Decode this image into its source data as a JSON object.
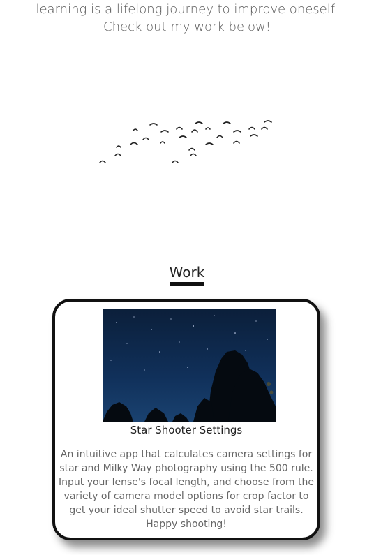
{
  "intro": {
    "line1": "learning is a lifelong journey to improve oneself.",
    "line2": "Check out my work below!"
  },
  "decoration": {
    "icon": "flock-of-birds-icon"
  },
  "work": {
    "heading": "Work",
    "projects": [
      {
        "title": "Star Shooter Settings",
        "image_icon": "night-sky-trees-image",
        "description_lines": [
          "An intuitive app that calculates camera settings for",
          "star and Milky Way photography using the 500 rule.",
          "Input your lense's focal length, and choose from the",
          "variety of camera model options for crop factor to",
          "get your ideal shutter speed to avoid star trails.",
          "Happy shooting!"
        ]
      }
    ]
  },
  "colors": {
    "text": "#5a5a5a",
    "heading": "#222222",
    "card_border": "#111111",
    "sky": "#0d2440"
  }
}
